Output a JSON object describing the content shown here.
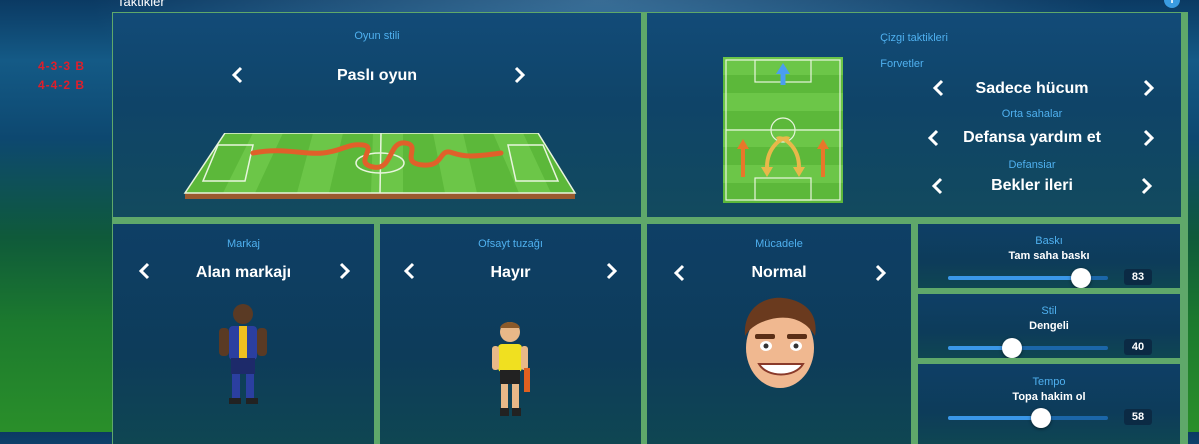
{
  "header": {
    "title": "Taktikler",
    "info_icon": "i"
  },
  "formations": [
    "4-3-3 B",
    "4-4-2 B"
  ],
  "play_style": {
    "label": "Oyun stili",
    "value": "Paslı oyun"
  },
  "line_tactics": {
    "label": "Çizgi taktikleri",
    "forwards": {
      "label": "Forvetler",
      "value": "Sadece hücum"
    },
    "midfielders": {
      "label": "Orta sahalar",
      "value": "Defansa yardım et"
    },
    "defenders": {
      "label": "Defansiar",
      "value": "Bekler ileri"
    }
  },
  "marking": {
    "label": "Markaj",
    "value": "Alan markajı"
  },
  "offside_trap": {
    "label": "Ofsayt tuzağı",
    "value": "Hayır"
  },
  "tackling": {
    "label": "Mücadele",
    "value": "Normal"
  },
  "sliders": {
    "pressing": {
      "label": "Baskı",
      "value_text": "Tam saha baskı",
      "value": 83
    },
    "style": {
      "label": "Stil",
      "value_text": "Dengeli",
      "value": 40
    },
    "tempo": {
      "label": "Tempo",
      "value_text": "Topa hakim ol",
      "value": 58
    }
  },
  "colors": {
    "accent_label": "#4fb0ef",
    "formation_red": "#e01e2a",
    "slider": "#3a97e8"
  },
  "icons": [
    "info-icon",
    "chevron-left-icon",
    "chevron-right-icon"
  ]
}
